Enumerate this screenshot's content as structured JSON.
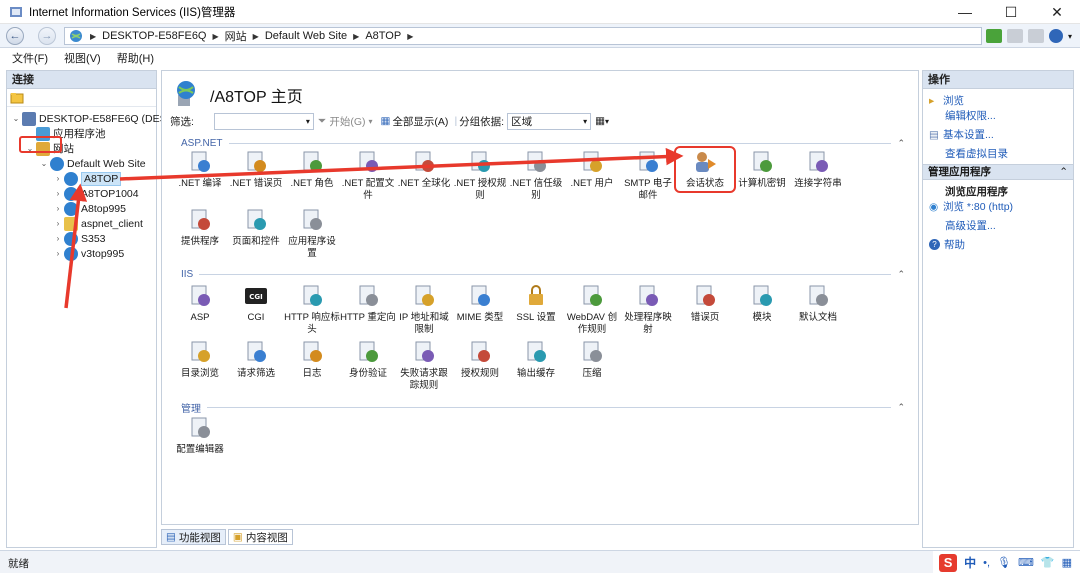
{
  "window": {
    "title": "Internet Information Services (IIS)管理器",
    "controls": {
      "minimize": "—",
      "maximize": "☐",
      "close": "✕"
    }
  },
  "address": {
    "crumbs": [
      "DESKTOP-E58FE6Q",
      "网站",
      "Default Web Site",
      "A8TOP"
    ]
  },
  "menu": {
    "items": [
      "文件(F)",
      "视图(V)",
      "帮助(H)"
    ]
  },
  "connections": {
    "header": "连接",
    "tree": [
      {
        "label": "DESKTOP-E58FE6Q (DESKT",
        "level": 0,
        "twist": "⌄",
        "icon": "server-icon"
      },
      {
        "label": "应用程序池",
        "level": 1,
        "twist": "",
        "icon": "app-pool-icon"
      },
      {
        "label": "网站",
        "level": 1,
        "twist": "⌄",
        "icon": "sites-folder-icon"
      },
      {
        "label": "Default Web Site",
        "level": 2,
        "twist": "⌄",
        "icon": "globe-icon"
      },
      {
        "label": "A8TOP",
        "level": 3,
        "twist": "›",
        "icon": "globe-icon",
        "selected": true
      },
      {
        "label": "A8TOP1004",
        "level": 3,
        "twist": "›",
        "icon": "globe-icon"
      },
      {
        "label": "A8top995",
        "level": 3,
        "twist": "›",
        "icon": "globe-icon"
      },
      {
        "label": "aspnet_client",
        "level": 3,
        "twist": "›",
        "icon": "folder-icon"
      },
      {
        "label": "S353",
        "level": 3,
        "twist": "›",
        "icon": "globe-icon"
      },
      {
        "label": "v3top995",
        "level": 3,
        "twist": "›",
        "icon": "globe-icon"
      }
    ]
  },
  "main": {
    "title": "/A8TOP 主页",
    "filter": {
      "label": "筛选:",
      "start": "开始(G)",
      "show_all": "全部显示(A)",
      "group_label": "分组依据:",
      "group_value": "区域"
    },
    "sections": [
      {
        "name": "ASP.NET",
        "items": [
          {
            "label": ".NET 编译",
            "icon": "net-compile-icon"
          },
          {
            "label": ".NET 错误页",
            "icon": "net-error-page-icon"
          },
          {
            "label": ".NET 角色",
            "icon": "net-roles-icon"
          },
          {
            "label": ".NET 配置文件",
            "icon": "net-profile-icon"
          },
          {
            "label": ".NET 全球化",
            "icon": "net-globalization-icon"
          },
          {
            "label": ".NET 授权规则",
            "icon": "net-authorization-icon"
          },
          {
            "label": ".NET 信任级别",
            "icon": "net-trust-icon"
          },
          {
            "label": ".NET 用户",
            "icon": "net-users-icon"
          },
          {
            "label": "SMTP 电子邮件",
            "icon": "smtp-email-icon"
          },
          {
            "label": "会话状态",
            "icon": "session-state-icon",
            "highlight": true
          },
          {
            "label": "计算机密钥",
            "icon": "machine-key-icon"
          },
          {
            "label": "连接字符串",
            "icon": "connection-strings-icon"
          },
          {
            "label": "提供程序",
            "icon": "providers-icon"
          },
          {
            "label": "页面和控件",
            "icon": "pages-controls-icon"
          },
          {
            "label": "应用程序设置",
            "icon": "app-settings-icon"
          }
        ]
      },
      {
        "name": "IIS",
        "items": [
          {
            "label": "ASP",
            "icon": "asp-icon"
          },
          {
            "label": "CGI",
            "icon": "cgi-icon"
          },
          {
            "label": "HTTP 响应标头",
            "icon": "http-headers-icon"
          },
          {
            "label": "HTTP 重定向",
            "icon": "http-redirect-icon"
          },
          {
            "label": "IP 地址和域限制",
            "icon": "ip-restrictions-icon"
          },
          {
            "label": "MIME 类型",
            "icon": "mime-types-icon"
          },
          {
            "label": "SSL 设置",
            "icon": "ssl-lock-icon"
          },
          {
            "label": "WebDAV 创作规则",
            "icon": "webdav-icon"
          },
          {
            "label": "处理程序映射",
            "icon": "handler-mappings-icon"
          },
          {
            "label": "错误页",
            "icon": "error-pages-icon"
          },
          {
            "label": "模块",
            "icon": "modules-icon"
          },
          {
            "label": "默认文档",
            "icon": "default-document-icon"
          },
          {
            "label": "目录浏览",
            "icon": "directory-browsing-icon"
          },
          {
            "label": "请求筛选",
            "icon": "request-filtering-icon"
          },
          {
            "label": "日志",
            "icon": "logging-icon"
          },
          {
            "label": "身份验证",
            "icon": "authentication-icon"
          },
          {
            "label": "失败请求跟踪规则",
            "icon": "failed-request-icon"
          },
          {
            "label": "授权规则",
            "icon": "authorization-rules-icon"
          },
          {
            "label": "输出缓存",
            "icon": "output-caching-icon"
          },
          {
            "label": "压缩",
            "icon": "compression-icon"
          }
        ]
      },
      {
        "name": "管理",
        "items": [
          {
            "label": "配置编辑器",
            "icon": "config-editor-icon"
          }
        ]
      }
    ]
  },
  "bottom_tabs": {
    "features": "功能视图",
    "content": "内容视图"
  },
  "actions": {
    "header": "操作",
    "browse": "浏览",
    "edit_permissions": "编辑权限...",
    "basic_settings": "基本设置...",
    "view_vdirs": "查看虚拟目录",
    "manage_app_header": "管理应用程序",
    "browse_app": "浏览应用程序",
    "browse_port": "浏览 *:80 (http)",
    "advanced_settings": "高级设置...",
    "help": "帮助"
  },
  "status": {
    "text": "就绪",
    "ime_lang": "中"
  },
  "colors": {
    "highlight_red": "#e8392c",
    "link_blue": "#1f5bb8",
    "panel_header": "#d9e3f0"
  }
}
